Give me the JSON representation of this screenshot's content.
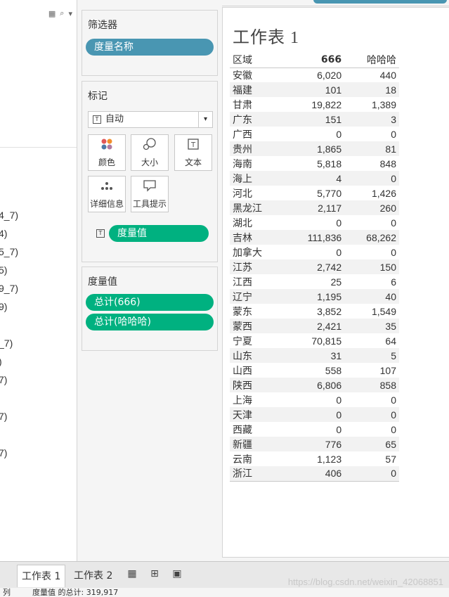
{
  "left_panel": {
    "toolbar_icons": [
      "grid-icon",
      "search-icon",
      "caret-down-icon"
    ],
    "field_fragments": [
      "4_7)",
      "4)",
      "5_7)",
      "5)",
      "9_7)",
      "9)",
      "_7)",
      ")",
      "7)",
      "7)",
      "7)"
    ]
  },
  "filters": {
    "title": "筛选器",
    "pill": "度量名称"
  },
  "marks": {
    "title": "标记",
    "type_select": "自动",
    "buttons": [
      {
        "label": "颜色",
        "icon": "color-icon"
      },
      {
        "label": "大小",
        "icon": "size-icon"
      },
      {
        "label": "文本",
        "icon": "text-icon"
      },
      {
        "label": "详细信息",
        "icon": "detail-icon"
      },
      {
        "label": "工具提示",
        "icon": "tooltip-icon"
      }
    ],
    "text_pill": "度量值"
  },
  "measure_values": {
    "title": "度量值",
    "pills": [
      "总计(666)",
      "总计(哈哈哈)"
    ]
  },
  "sheet": {
    "title": "工作表 1",
    "columns": [
      "区域",
      "666",
      "哈哈哈"
    ],
    "rows": [
      [
        "安徽",
        "6,020",
        "440"
      ],
      [
        "福建",
        "101",
        "18"
      ],
      [
        "甘肃",
        "19,822",
        "1,389"
      ],
      [
        "广东",
        "151",
        "3"
      ],
      [
        "广西",
        "0",
        "0"
      ],
      [
        "贵州",
        "1,865",
        "81"
      ],
      [
        "海南",
        "5,818",
        "848"
      ],
      [
        "海上",
        "4",
        "0"
      ],
      [
        "河北",
        "5,770",
        "1,426"
      ],
      [
        "黑龙江",
        "2,117",
        "260"
      ],
      [
        "湖北",
        "0",
        "0"
      ],
      [
        "吉林",
        "111,836",
        "68,262"
      ],
      [
        "加拿大",
        "0",
        "0"
      ],
      [
        "江苏",
        "2,742",
        "150"
      ],
      [
        "江西",
        "25",
        "6"
      ],
      [
        "辽宁",
        "1,195",
        "40"
      ],
      [
        "蒙东",
        "3,852",
        "1,549"
      ],
      [
        "蒙西",
        "2,421",
        "35"
      ],
      [
        "宁夏",
        "70,815",
        "64"
      ],
      [
        "山东",
        "31",
        "5"
      ],
      [
        "山西",
        "558",
        "107"
      ],
      [
        "陕西",
        "6,806",
        "858"
      ],
      [
        "上海",
        "0",
        "0"
      ],
      [
        "天津",
        "0",
        "0"
      ],
      [
        "西藏",
        "0",
        "0"
      ],
      [
        "新疆",
        "776",
        "65"
      ],
      [
        "云南",
        "1,123",
        "57"
      ],
      [
        "浙江",
        "406",
        "0"
      ]
    ]
  },
  "tabs": {
    "active": "工作表 1",
    "other": "工作表 2",
    "icons": [
      "new-worksheet-icon",
      "new-dashboard-icon",
      "new-story-icon"
    ]
  },
  "statusbar": {
    "left": "列",
    "summary": "度量值 的总计: 319,917"
  },
  "watermark": "https://blog.csdn.net/weixin_42068851",
  "colors": {
    "blue_pill": "#4996b2",
    "green_pill": "#00b180"
  }
}
